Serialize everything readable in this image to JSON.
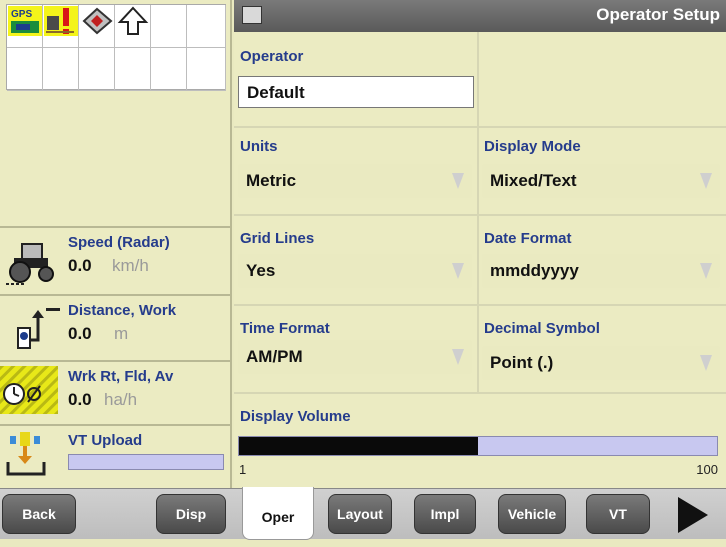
{
  "status_grid": {
    "gps_label": "GPS",
    "icons": [
      "gps-satellite-icon",
      "warning-exclamation-icon",
      "implement-icon",
      "up-arrow-icon"
    ]
  },
  "left_panel": {
    "rows": [
      {
        "title": "Speed (Radar)",
        "value": "0.0",
        "unit": "km/h",
        "icon": "tractor-icon"
      },
      {
        "title": "Distance, Work",
        "value": "0.0",
        "unit": "m",
        "icon": "distance-icon"
      },
      {
        "title": "Wrk Rt, Fld, Av",
        "value": "0.0",
        "unit": "ha/h",
        "icon": "work-rate-icon"
      },
      {
        "title": "VT Upload",
        "value": "",
        "unit": "",
        "icon": "vt-upload-icon"
      }
    ]
  },
  "main": {
    "title": "Operator Setup",
    "operator": {
      "label": "Operator",
      "value": "Default"
    },
    "units": {
      "label": "Units",
      "value": "Metric"
    },
    "display_mode": {
      "label": "Display Mode",
      "value": "Mixed/Text"
    },
    "grid_lines": {
      "label": "Grid Lines",
      "value": "Yes"
    },
    "date_format": {
      "label": "Date Format",
      "value": "mmddyyyy"
    },
    "time_format": {
      "label": "Time Format",
      "value": "AM/PM"
    },
    "decimal_symbol": {
      "label": "Decimal Symbol",
      "value": "Point (.)"
    },
    "display_volume": {
      "label": "Display Volume",
      "min": "1",
      "max": "100",
      "level": 0.5
    }
  },
  "bottom_bar": {
    "buttons": [
      "Back",
      "Disp",
      "Oper",
      "Layout",
      "Impl",
      "Vehicle",
      "VT"
    ],
    "active": "Oper",
    "next_icon": "right-arrow-icon"
  },
  "colors": {
    "label_blue": "#253c8c",
    "panel_bg": "#ebebc2",
    "title_bar": "#5a5a5a"
  }
}
